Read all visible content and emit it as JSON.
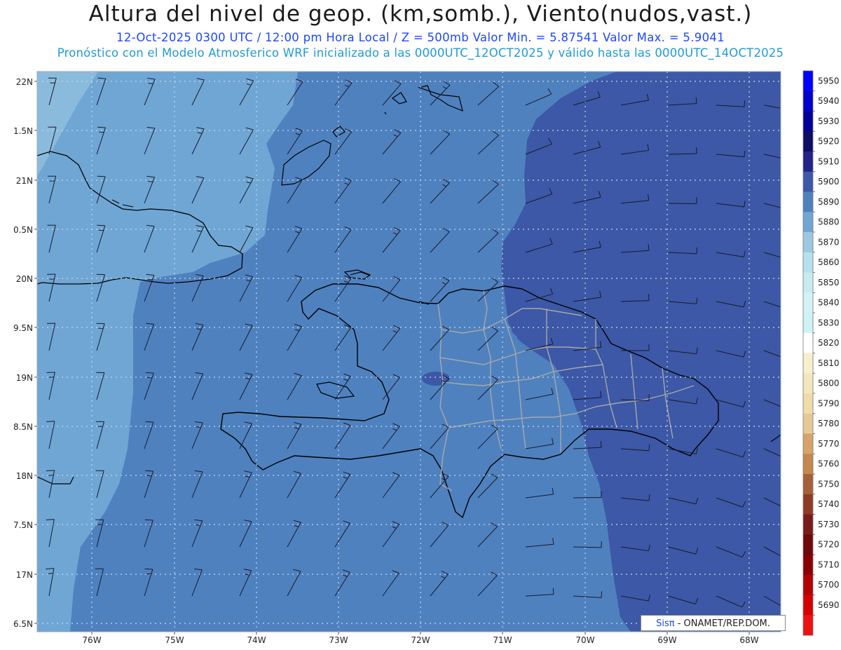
{
  "header": {
    "title": "Altura del nivel de geop. (km,somb.), Viento(nudos,vast.)",
    "subtitle": "12-Oct-2025  0300 UTC / 12:00 pm Hora Local / Z = 500mb    Valor Min. = 5.87541  Valor Max. = 5.9041",
    "subtitle2": "Pronóstico con el Modelo Atmosferico WRF inicializado a las 0000UTC_12OCT2025 y válido hasta las  0000UTC_14OCT2025"
  },
  "map": {
    "lat_labels": [
      "22N",
      "1.5N",
      "21N",
      "0.5N",
      "20N",
      "9.5N",
      "19N",
      "8.5N",
      "18N",
      "7.5N",
      "17N",
      "6.5N"
    ],
    "lon_labels": [
      "76W",
      "75W",
      "74W",
      "73W",
      "72W",
      "71W",
      "70W",
      "69W",
      "68W"
    ],
    "lon_range": [
      -76.65,
      -67.55
    ],
    "lat_range": [
      16.45,
      22.05
    ],
    "grid": true,
    "fill_colors": {
      "5880": "#6fa6d4",
      "5890": "#4f81bf",
      "5900": "#3c58a6",
      "5910": "#2a3a94"
    }
  },
  "colorbar": {
    "levels": [
      "5950",
      "5940",
      "5930",
      "5920",
      "5910",
      "5900",
      "5890",
      "5880",
      "5870",
      "5860",
      "5850",
      "5840",
      "5830",
      "5820",
      "5810",
      "5800",
      "5790",
      "5780",
      "5770",
      "5760",
      "5750",
      "5740",
      "5730",
      "5720",
      "5710",
      "5700",
      "5690"
    ],
    "colors": [
      "#0000ff",
      "#0000cc",
      "#000099",
      "#0d0d66",
      "#222288",
      "#3c58a6",
      "#4f81bf",
      "#6fa6d4",
      "#9cc8e2",
      "#b6e1ee",
      "#c6ecf2",
      "#d4f2f6",
      "#cdf3f7",
      "#ffffff",
      "#f8f0cc",
      "#f4e7bd",
      "#efdcaa",
      "#e6c996",
      "#d6a46a",
      "#c4884e",
      "#a7603b",
      "#8f3c26",
      "#7a1c1c",
      "#6e0a0a",
      "#8a0000",
      "#b40000",
      "#d60000",
      "#ee1111"
    ]
  },
  "credit": {
    "sis": "Sisπ",
    "rest": "- ONAMET/REP.DOM."
  }
}
